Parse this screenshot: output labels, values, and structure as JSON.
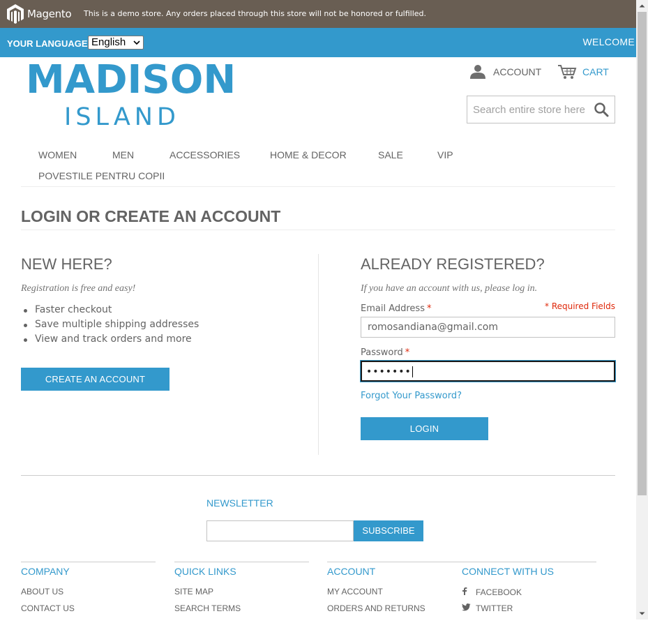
{
  "demo_notice": {
    "brand": "Magento",
    "text": "This is a demo store. Any orders placed through this store will not be honored or fulfilled."
  },
  "language_bar": {
    "label": "YOUR LANGUAGE:",
    "selected": "English",
    "welcome": "WELCOME"
  },
  "header": {
    "logo_main": "MADISON",
    "logo_sub": "ISLAND",
    "account_label": "ACCOUNT",
    "cart_label": "CART",
    "search_placeholder": "Search entire store here..."
  },
  "nav": {
    "items": [
      "WOMEN",
      "MEN",
      "ACCESSORIES",
      "HOME & DECOR",
      "SALE",
      "VIP",
      "POVESTILE PENTRU COPII"
    ]
  },
  "page": {
    "title": "LOGIN OR CREATE AN ACCOUNT"
  },
  "new_customer": {
    "title": "NEW HERE?",
    "intro": "Registration is free and easy!",
    "benefits": [
      "Faster checkout",
      "Save multiple shipping addresses",
      "View and track orders and more"
    ],
    "button": "CREATE AN ACCOUNT"
  },
  "login": {
    "title": "ALREADY REGISTERED?",
    "intro": "If you have an account with us, please log in.",
    "required_note": "* Required Fields",
    "email_label": "Email Address",
    "email_value": "romosandiana@gmail.com",
    "password_label": "Password",
    "password_masked": "•••••••",
    "required_mark": "*",
    "forgot": "Forgot Your Password?",
    "button": "LOGIN"
  },
  "newsletter": {
    "title": "NEWSLETTER",
    "button": "SUBSCRIBE"
  },
  "footer": {
    "company": {
      "title": "COMPANY",
      "links": [
        "ABOUT US",
        "CONTACT US"
      ]
    },
    "quick_links": {
      "title": "QUICK LINKS",
      "links": [
        "SITE MAP",
        "SEARCH TERMS"
      ]
    },
    "account": {
      "title": "ACCOUNT",
      "links": [
        "MY ACCOUNT",
        "ORDERS AND RETURNS"
      ]
    },
    "connect": {
      "title": "CONNECT WITH US",
      "links": [
        "FACEBOOK",
        "TWITTER"
      ]
    }
  },
  "colors": {
    "brand_blue": "#3399cc",
    "demo_bar": "#695e53",
    "text": "#636363",
    "required": "#df280a"
  }
}
